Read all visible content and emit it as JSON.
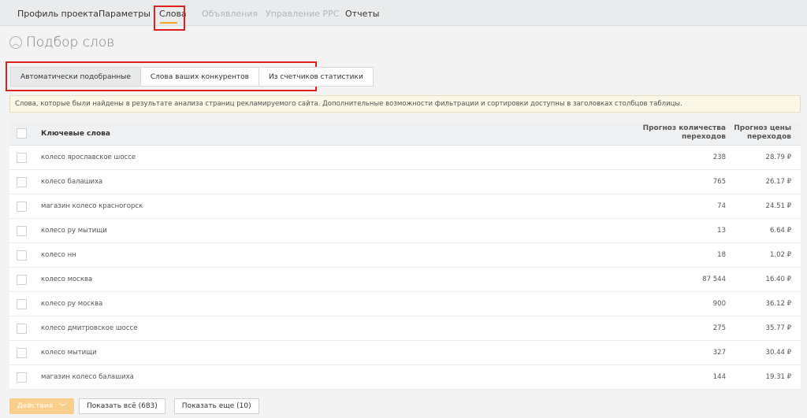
{
  "nav": {
    "tabs": [
      {
        "label": "Профиль проекта",
        "disabled": false
      },
      {
        "label": "Параметры",
        "disabled": false
      },
      {
        "label": "Слова",
        "disabled": false
      },
      {
        "label": "Объявления",
        "disabled": true
      },
      {
        "label": "Управление PPC",
        "disabled": true
      },
      {
        "label": "Отчеты",
        "disabled": false
      }
    ]
  },
  "page": {
    "title": "Подбор слов",
    "collapse_icon": "chevron-up-icon"
  },
  "subtabs": [
    {
      "label": "Автоматически подобранные",
      "active": true
    },
    {
      "label": "Слова ваших конкурентов",
      "active": false
    },
    {
      "label": "Из счетчиков статистики",
      "active": false
    }
  ],
  "info": "Слова, которые были найдены в результате анализа страниц рекламируемого сайта. Дополнительные возможности фильтрации и сортировки доступны в заголовках столбцов таблицы.",
  "table": {
    "headers": {
      "keywords": "Ключевые слова",
      "clicks_line1": "Прогноз количества",
      "clicks_line2": "переходов",
      "price_line1": "Прогноз цены",
      "price_line2": "переходов"
    },
    "rows": [
      {
        "keyword": "колесо ярославское шоссе",
        "clicks": "238",
        "price": "28.79 ₽"
      },
      {
        "keyword": "колесо балашиха",
        "clicks": "765",
        "price": "26.17 ₽"
      },
      {
        "keyword": "магазин колесо красногорск",
        "clicks": "74",
        "price": "24.51 ₽"
      },
      {
        "keyword": "колесо ру мытищи",
        "clicks": "13",
        "price": "6.64 ₽"
      },
      {
        "keyword": "колесо нн",
        "clicks": "18",
        "price": "1.02 ₽"
      },
      {
        "keyword": "колесо москва",
        "clicks": "87 544",
        "price": "16.40 ₽"
      },
      {
        "keyword": "колесо ру москва",
        "clicks": "900",
        "price": "36.12 ₽"
      },
      {
        "keyword": "колесо дмитровское шоссе",
        "clicks": "275",
        "price": "35.77 ₽"
      },
      {
        "keyword": "колесо мытищи",
        "clicks": "327",
        "price": "30.44 ₽"
      },
      {
        "keyword": "магазин колесо балашиха",
        "clicks": "144",
        "price": "19.31 ₽"
      }
    ]
  },
  "footer": {
    "actions_label": "Действия",
    "show_all_label": "Показать всё (683)",
    "show_more_label": "Показать еще (10)"
  },
  "colors": {
    "accent": "#f5a623",
    "highlight": "#e02020",
    "actions_button": "#f8cf8a"
  }
}
